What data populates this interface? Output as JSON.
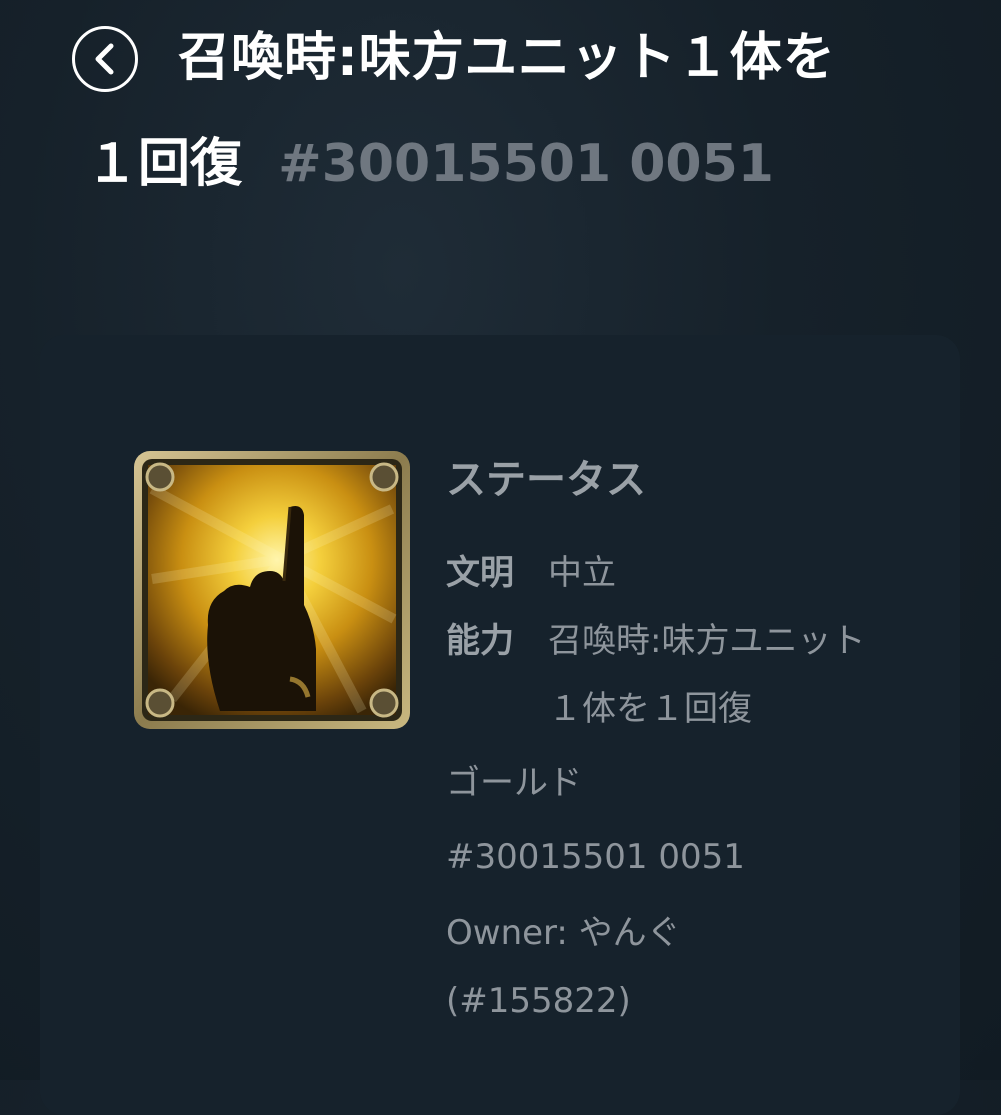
{
  "header": {
    "title_line1": "召喚時:味方ユニット１体を",
    "title_line2": "１回復",
    "title_id": "#30015501 0051"
  },
  "status": {
    "title": "ステータス",
    "civ_label": "文明",
    "civ_value": "中立",
    "ability_label": "能力",
    "ability_value": "召喚時:味方ユニット１体を１回復",
    "rarity": "ゴールド",
    "id": "#30015501 0051",
    "owner": "Owner: やんぐ (#155822)"
  },
  "icons": {
    "back": "chevron-left-icon",
    "item": "pointing-hand-icon"
  },
  "colors": {
    "background": "#16212a",
    "card": "#16222c",
    "title": "#ffffff",
    "muted_text": "#8e959c",
    "gold_frame": "#a99762"
  }
}
